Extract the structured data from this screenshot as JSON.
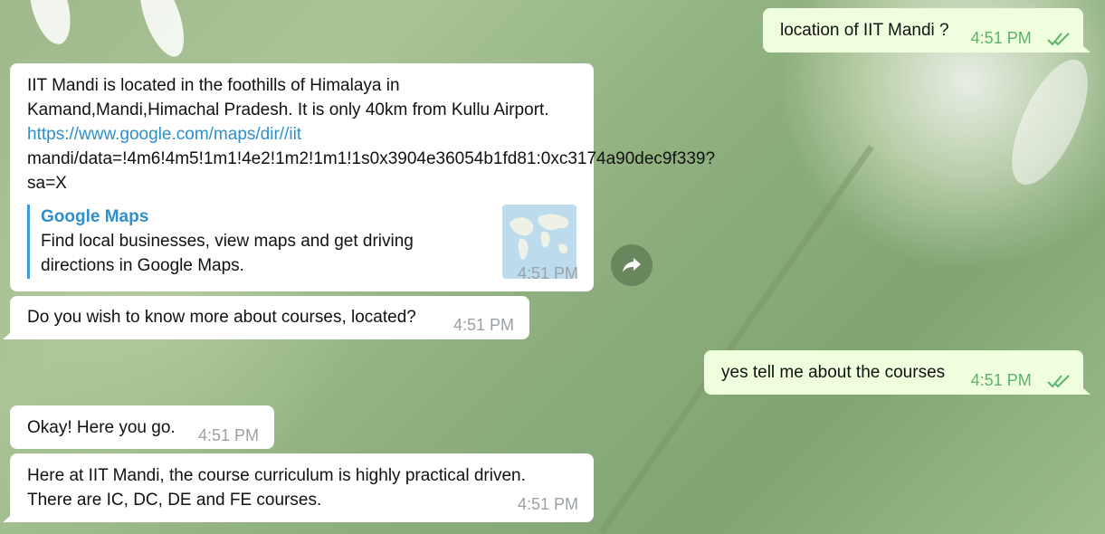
{
  "messages": {
    "m1": {
      "text": "location of IIT Mandi ?",
      "time": "4:51 PM"
    },
    "m2": {
      "text": "IIT Mandi is located in the foothills of Himalaya in Kamand,Mandi,Himachal Pradesh. It is only 40km from Kullu Airport.",
      "link": "https://www.google.com/maps/dir//iit",
      "link_rest": " mandi/data=!4m6!4m5!1m1!4e2!1m2!1m1!1s0x3904e36054b1fd81:0xc3174a90dec9f339?sa=X",
      "preview_title": "Google Maps",
      "preview_desc": "Find local businesses, view maps and get driving directions in Google Maps.",
      "time": "4:51 PM"
    },
    "m3": {
      "text": "Do you wish to know more about courses, located?",
      "time": "4:51 PM"
    },
    "m4": {
      "text": "yes tell me about the courses",
      "time": "4:51 PM"
    },
    "m5": {
      "text": "Okay! Here you go.",
      "time": "4:51 PM"
    },
    "m6": {
      "text": "Here at IIT Mandi, the course curriculum is highly practical driven. There are IC, DC, DE and FE courses.",
      "time": "4:51 PM"
    }
  },
  "icons": {
    "share": "share-arrow-icon",
    "read": "double-check-icon"
  },
  "colors": {
    "incoming": "#ffffff",
    "outgoing": "#effedd",
    "link": "#2e8fc9",
    "read_ticks": "#5ab56c"
  }
}
